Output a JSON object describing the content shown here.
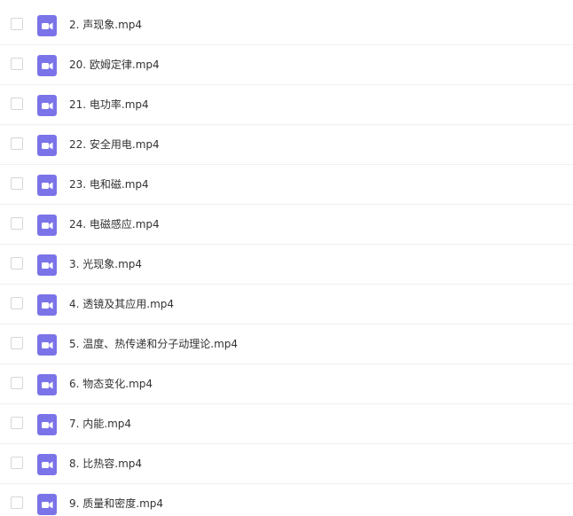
{
  "icons": {
    "file": "video-file-icon",
    "color": "#7b73e8"
  },
  "files": [
    {
      "name": "2. 声现象.mp4"
    },
    {
      "name": "20. 欧姆定律.mp4"
    },
    {
      "name": "21. 电功率.mp4"
    },
    {
      "name": "22. 安全用电.mp4"
    },
    {
      "name": "23. 电和磁.mp4"
    },
    {
      "name": "24. 电磁感应.mp4"
    },
    {
      "name": "3. 光现象.mp4"
    },
    {
      "name": "4. 透镜及其应用.mp4"
    },
    {
      "name": "5. 温度、热传递和分子动理论.mp4"
    },
    {
      "name": "6. 物态变化.mp4"
    },
    {
      "name": "7. 内能.mp4"
    },
    {
      "name": "8. 比热容.mp4"
    },
    {
      "name": "9. 质量和密度.mp4"
    }
  ]
}
